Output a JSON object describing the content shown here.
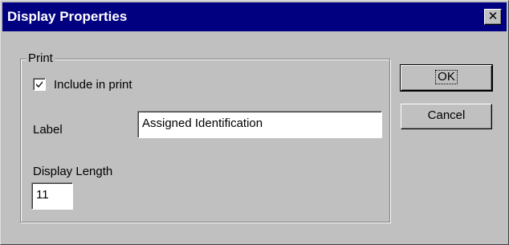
{
  "window": {
    "title": "Display Properties",
    "close_glyph": "✕",
    "close_icon": "close-icon"
  },
  "print_group": {
    "legend": "Print",
    "include_checkbox": {
      "label": "Include in print",
      "checked": true
    },
    "label_field": {
      "label": "Label",
      "value": "Assigned Identification"
    },
    "length_field": {
      "label": "Display Length",
      "value": "11"
    }
  },
  "buttons": {
    "ok_label": "OK",
    "cancel_label": "Cancel"
  },
  "colors": {
    "titlebar": "#000080",
    "face": "#c0c0c0"
  }
}
